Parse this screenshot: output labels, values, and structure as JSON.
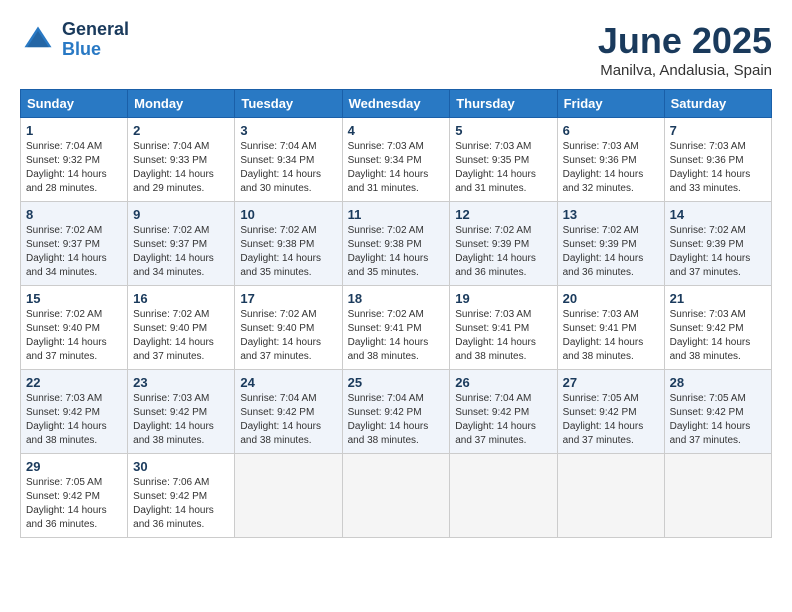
{
  "header": {
    "logo_line1": "General",
    "logo_line2": "Blue",
    "month_title": "June 2025",
    "subtitle": "Manilva, Andalusia, Spain"
  },
  "weekdays": [
    "Sunday",
    "Monday",
    "Tuesday",
    "Wednesday",
    "Thursday",
    "Friday",
    "Saturday"
  ],
  "weeks": [
    [
      {
        "day": "1",
        "sunrise": "7:04 AM",
        "sunset": "9:32 PM",
        "daylight": "14 hours and 28 minutes."
      },
      {
        "day": "2",
        "sunrise": "7:04 AM",
        "sunset": "9:33 PM",
        "daylight": "14 hours and 29 minutes."
      },
      {
        "day": "3",
        "sunrise": "7:04 AM",
        "sunset": "9:34 PM",
        "daylight": "14 hours and 30 minutes."
      },
      {
        "day": "4",
        "sunrise": "7:03 AM",
        "sunset": "9:34 PM",
        "daylight": "14 hours and 31 minutes."
      },
      {
        "day": "5",
        "sunrise": "7:03 AM",
        "sunset": "9:35 PM",
        "daylight": "14 hours and 31 minutes."
      },
      {
        "day": "6",
        "sunrise": "7:03 AM",
        "sunset": "9:36 PM",
        "daylight": "14 hours and 32 minutes."
      },
      {
        "day": "7",
        "sunrise": "7:03 AM",
        "sunset": "9:36 PM",
        "daylight": "14 hours and 33 minutes."
      }
    ],
    [
      {
        "day": "8",
        "sunrise": "7:02 AM",
        "sunset": "9:37 PM",
        "daylight": "14 hours and 34 minutes."
      },
      {
        "day": "9",
        "sunrise": "7:02 AM",
        "sunset": "9:37 PM",
        "daylight": "14 hours and 34 minutes."
      },
      {
        "day": "10",
        "sunrise": "7:02 AM",
        "sunset": "9:38 PM",
        "daylight": "14 hours and 35 minutes."
      },
      {
        "day": "11",
        "sunrise": "7:02 AM",
        "sunset": "9:38 PM",
        "daylight": "14 hours and 35 minutes."
      },
      {
        "day": "12",
        "sunrise": "7:02 AM",
        "sunset": "9:39 PM",
        "daylight": "14 hours and 36 minutes."
      },
      {
        "day": "13",
        "sunrise": "7:02 AM",
        "sunset": "9:39 PM",
        "daylight": "14 hours and 36 minutes."
      },
      {
        "day": "14",
        "sunrise": "7:02 AM",
        "sunset": "9:39 PM",
        "daylight": "14 hours and 37 minutes."
      }
    ],
    [
      {
        "day": "15",
        "sunrise": "7:02 AM",
        "sunset": "9:40 PM",
        "daylight": "14 hours and 37 minutes."
      },
      {
        "day": "16",
        "sunrise": "7:02 AM",
        "sunset": "9:40 PM",
        "daylight": "14 hours and 37 minutes."
      },
      {
        "day": "17",
        "sunrise": "7:02 AM",
        "sunset": "9:40 PM",
        "daylight": "14 hours and 37 minutes."
      },
      {
        "day": "18",
        "sunrise": "7:02 AM",
        "sunset": "9:41 PM",
        "daylight": "14 hours and 38 minutes."
      },
      {
        "day": "19",
        "sunrise": "7:03 AM",
        "sunset": "9:41 PM",
        "daylight": "14 hours and 38 minutes."
      },
      {
        "day": "20",
        "sunrise": "7:03 AM",
        "sunset": "9:41 PM",
        "daylight": "14 hours and 38 minutes."
      },
      {
        "day": "21",
        "sunrise": "7:03 AM",
        "sunset": "9:42 PM",
        "daylight": "14 hours and 38 minutes."
      }
    ],
    [
      {
        "day": "22",
        "sunrise": "7:03 AM",
        "sunset": "9:42 PM",
        "daylight": "14 hours and 38 minutes."
      },
      {
        "day": "23",
        "sunrise": "7:03 AM",
        "sunset": "9:42 PM",
        "daylight": "14 hours and 38 minutes."
      },
      {
        "day": "24",
        "sunrise": "7:04 AM",
        "sunset": "9:42 PM",
        "daylight": "14 hours and 38 minutes."
      },
      {
        "day": "25",
        "sunrise": "7:04 AM",
        "sunset": "9:42 PM",
        "daylight": "14 hours and 38 minutes."
      },
      {
        "day": "26",
        "sunrise": "7:04 AM",
        "sunset": "9:42 PM",
        "daylight": "14 hours and 37 minutes."
      },
      {
        "day": "27",
        "sunrise": "7:05 AM",
        "sunset": "9:42 PM",
        "daylight": "14 hours and 37 minutes."
      },
      {
        "day": "28",
        "sunrise": "7:05 AM",
        "sunset": "9:42 PM",
        "daylight": "14 hours and 37 minutes."
      }
    ],
    [
      {
        "day": "29",
        "sunrise": "7:05 AM",
        "sunset": "9:42 PM",
        "daylight": "14 hours and 36 minutes."
      },
      {
        "day": "30",
        "sunrise": "7:06 AM",
        "sunset": "9:42 PM",
        "daylight": "14 hours and 36 minutes."
      },
      null,
      null,
      null,
      null,
      null
    ]
  ]
}
